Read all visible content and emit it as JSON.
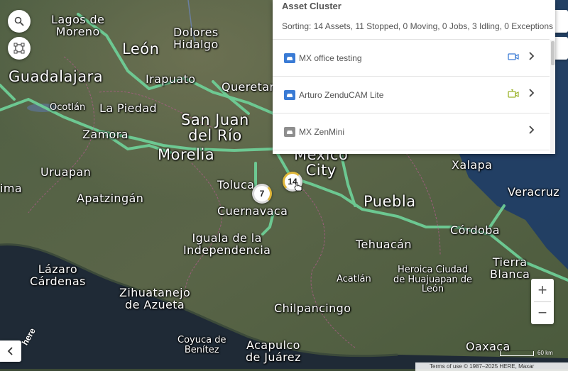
{
  "panel": {
    "title": "Asset Cluster",
    "summary": "Sorting: 14 Assets, 11 Stopped, 0 Moving, 0 Jobs, 3 Idling, 0 Exceptions",
    "assets": [
      {
        "name": "MX office testing",
        "icon": "car-icon",
        "icon_color": "#3a7bd5",
        "camera": "video-camera-icon",
        "camera_color": "#3a7bd5"
      },
      {
        "name": "Arturo ZenduCAM Lite",
        "icon": "car-icon",
        "icon_color": "#3a7bd5",
        "camera": "camera-alert-icon",
        "camera_color": "#9bb32a"
      },
      {
        "name": "MX ZenMini",
        "icon": "car-icon",
        "icon_color": "#8e8e8e"
      }
    ]
  },
  "map": {
    "clusters": [
      "7",
      "14"
    ],
    "cities": {
      "lagos": "Lagos de\nMoreno",
      "leon": "León",
      "dolores": "Dolores\nHidalgo",
      "guadalajara": "Guadalajara",
      "irapuato": "Irapuato",
      "queretaro": "Queretaro",
      "ocotlan": "Ocotlán",
      "lapiedad": "La Piedad",
      "sanjuan": "San Juan\ndel Río",
      "zamora": "Zamora",
      "morelia": "Morelia",
      "mexicocity": "Mexico\nCity",
      "xalapa": "Xalapa",
      "uruapan": "Uruapan",
      "toluca": "Toluca",
      "veracruz": "Veracruz",
      "ima": "ima",
      "apatzingan": "Apatzingán",
      "puebla": "Puebla",
      "cuernavaca": "Cuernavaca",
      "cordoba": "Córdoba",
      "iguala": "Iguala de la\nIndependencia",
      "tehuacan": "Tehuacán",
      "tierrablanca": "Tierra\nBlanca",
      "lazaro": "Lázaro\nCárdenas",
      "heroica": "Heroica Ciudad\nde Huajuapan de\nLeón",
      "acatlan": "Acatlán",
      "zihuatanejo": "Zihuatanejo\nde Azueta",
      "chilpancingo": "Chilpancingo",
      "coyuca": "Coyuca de\nBenítez",
      "acapulco": "Acapulco\nde Juárez",
      "oaxaca": "Oaxaca"
    },
    "scale_label": "60 km",
    "attribution": "Terms of use   © 1987–2025 HERE, Maxar",
    "here_logo": "here"
  },
  "controls": {
    "zoom_in": "+",
    "zoom_out": "−"
  }
}
